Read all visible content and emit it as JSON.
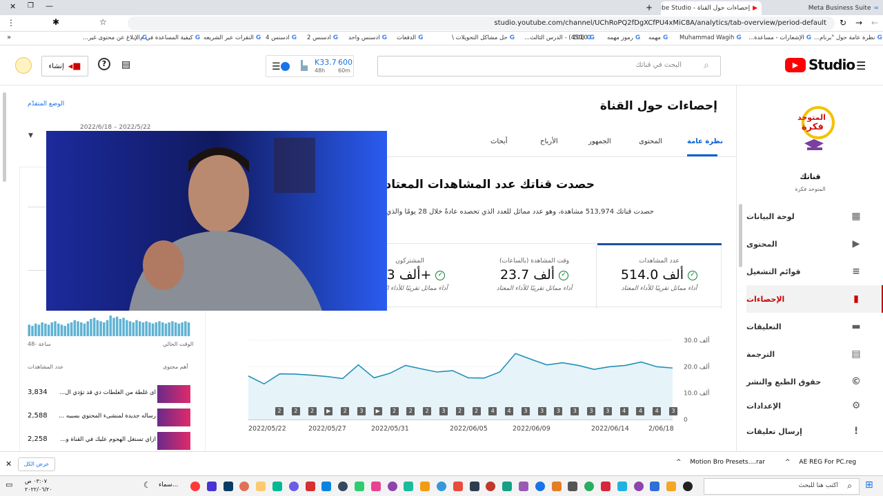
{
  "browser": {
    "tabs": [
      {
        "label": "Meta Business Suite"
      },
      {
        "label": "إحصاءات حول القناة - YouTube Studio"
      }
    ],
    "url": "studio.youtube.com/channel/UChRoPQ2fDgXCfPU4xMiC8A/analytics/tab-overview/period-default",
    "bookmarks": [
      "نظرة عامة حول \"برنام...",
      "الإشعارات - مساعدة...",
      "Muhammad Wagih",
      "مهمه",
      "رموز مهمه",
      "1010",
      "(450) - الدرس الثالث...",
      "حل مشاكل التحويلات \\",
      "الدفعات",
      "ادسنس واحد",
      "ادسنس 2",
      "ادسنس 4",
      "النقرات عبر الشريعه",
      "كيفية المساعدة في م...",
      "الإبلاغ عن محتوى غير..."
    ]
  },
  "header": {
    "logo_text": "Studio",
    "search_placeholder": "البحث في قناتك",
    "realtime_value": "600",
    "realtime_label": "60m",
    "realtime_value2": "K33.7",
    "realtime_label2": "48h",
    "create_label": "إنشاء"
  },
  "sidebar": {
    "channel_title": "قناتك",
    "channel_name": "المتوحد فكرة",
    "items": [
      {
        "label": "لوحة البيانات",
        "icon": "dashboard-icon"
      },
      {
        "label": "المحتوى",
        "icon": "play-icon"
      },
      {
        "label": "قوائم التشغيل",
        "icon": "playlist-icon"
      },
      {
        "label": "الإحصاءات",
        "icon": "analytics-icon"
      },
      {
        "label": "التعليقات",
        "icon": "comment-icon"
      },
      {
        "label": "الترجمة",
        "icon": "subtitles-icon"
      },
      {
        "label": "حقوق الطبع والنشر",
        "icon": "copyright-icon"
      },
      {
        "label": "الإعدادات",
        "icon": "gear-icon"
      },
      {
        "label": "إرسال تعليقات",
        "icon": "feedback-icon"
      }
    ],
    "active_color": "#cc0000"
  },
  "page": {
    "title": "إحصاءات حول القناة",
    "advanced_mode": "الوضع المتقدّم",
    "date_range": "2022/6/18 – 2022/5/22",
    "tabs": [
      "نظرة عامة",
      "المحتوى",
      "الجمهور",
      "الأرباح",
      "أبحاث"
    ],
    "headline": "حصدت قناتك عدد المشاهدات المعتاد نفسه",
    "subtext": "حصدت قناتك 513,974 مشاهدة، وهو عدد مماثل للعدد الذي تحصده عادةً خلال 28 يومًا والذي يتراوح",
    "kpis": [
      {
        "title": "عدد المشاهدات",
        "value": "514.0",
        "unit": "ألف",
        "status": "أداء مماثل تقريبًا للأداء المعتاد"
      },
      {
        "title": "وقت المشاهدة (بالساعات)",
        "value": "23.7",
        "unit": "ألف",
        "status": "أداء مماثل تقريبًا للأداء المعتاد"
      },
      {
        "title": "المشتركون",
        "value": "4.3+",
        "unit": "ألف",
        "status": "أداء مماثل تقريبًا للأداء المعتاد"
      }
    ]
  },
  "realtime": {
    "now_label": "الوقت الحالي",
    "hours_label": "48- ساعة",
    "views_col": "عدد المشاهدات",
    "content_col": "أهم محتوى",
    "top_content": [
      {
        "title": "اى غلطة من الغلطات دي قد تؤدي ال...",
        "views": "3,834"
      },
      {
        "title": "رساله جديدة لمنشىء المحتوي بسببه ...",
        "views": "2,588"
      },
      {
        "title": "ازاي تستغل الهجوم عليك في القناة و...",
        "views": "2,258"
      }
    ],
    "see_all": "عرض الكل"
  },
  "chart_data": {
    "type": "line",
    "x": [
      "2022/05/22",
      "2022/05/23",
      "2022/05/24",
      "2022/05/25",
      "2022/05/26",
      "2022/05/27",
      "2022/05/28",
      "2022/05/29",
      "2022/05/30",
      "2022/05/31",
      "2022/06/01",
      "2022/06/02",
      "2022/06/03",
      "2022/06/04",
      "2022/06/05",
      "2022/06/06",
      "2022/06/07",
      "2022/06/08",
      "2022/06/09",
      "2022/06/10",
      "2022/06/11",
      "2022/06/12",
      "2022/06/13",
      "2022/06/14",
      "2022/06/15",
      "2022/06/16",
      "2022/06/17",
      "2022/06/18"
    ],
    "values": [
      16.5,
      13.5,
      17.3,
      17.2,
      16.8,
      16.3,
      15.5,
      20.7,
      15.8,
      17.5,
      20.5,
      19.2,
      18.0,
      18.5,
      15.8,
      15.7,
      18.0,
      25.0,
      22.8,
      20.7,
      21.5,
      20.5,
      19.0,
      20.0,
      20.5,
      21.8,
      20.0,
      19.5
    ],
    "ylim": [
      0,
      30
    ],
    "yticks": [
      {
        "v": 0,
        "label": "0"
      },
      {
        "v": 10,
        "label": "10.0 ألف"
      },
      {
        "v": 20,
        "label": "20.0 ألف"
      },
      {
        "v": 30,
        "label": "30.0 ألف"
      }
    ],
    "xtick_labels": [
      "2022/05/22",
      "2022/05/27",
      "2022/05/31",
      "2022/06/05",
      "2022/06/09",
      "2022/06/14",
      "2/06/18"
    ],
    "events": [
      "2",
      "2",
      "2",
      "▶",
      "2",
      "3",
      "▶",
      "2",
      "2",
      "2",
      "3",
      "2",
      "2",
      "4",
      "4",
      "3",
      "3",
      "3",
      "3",
      "3",
      "3",
      "4",
      "4",
      "4",
      "3"
    ],
    "line_color": "#2190b6",
    "fill_color": "#e6f3f8",
    "sparkline": [
      10,
      9,
      11,
      10,
      12,
      11,
      10,
      12,
      13,
      11,
      10,
      9,
      11,
      12,
      14,
      13,
      12,
      11,
      13,
      15,
      16,
      14,
      13,
      12,
      14,
      18,
      16,
      17,
      15,
      16,
      14,
      13,
      12,
      14,
      13,
      12,
      13,
      12,
      11,
      12,
      13,
      12,
      11,
      12,
      13,
      12,
      11,
      12,
      13,
      12
    ]
  },
  "downloads": [
    {
      "name": "AE REG For PC.reg"
    },
    {
      "name": "Motion Bro Presets....rar"
    }
  ],
  "taskbar": {
    "search_placeholder": "اكتب هنا للبحث",
    "weather": "سماء...",
    "time": "٠٣:٠٧ ص",
    "date": "٢٠٢٢/٠٦/٢٠"
  }
}
